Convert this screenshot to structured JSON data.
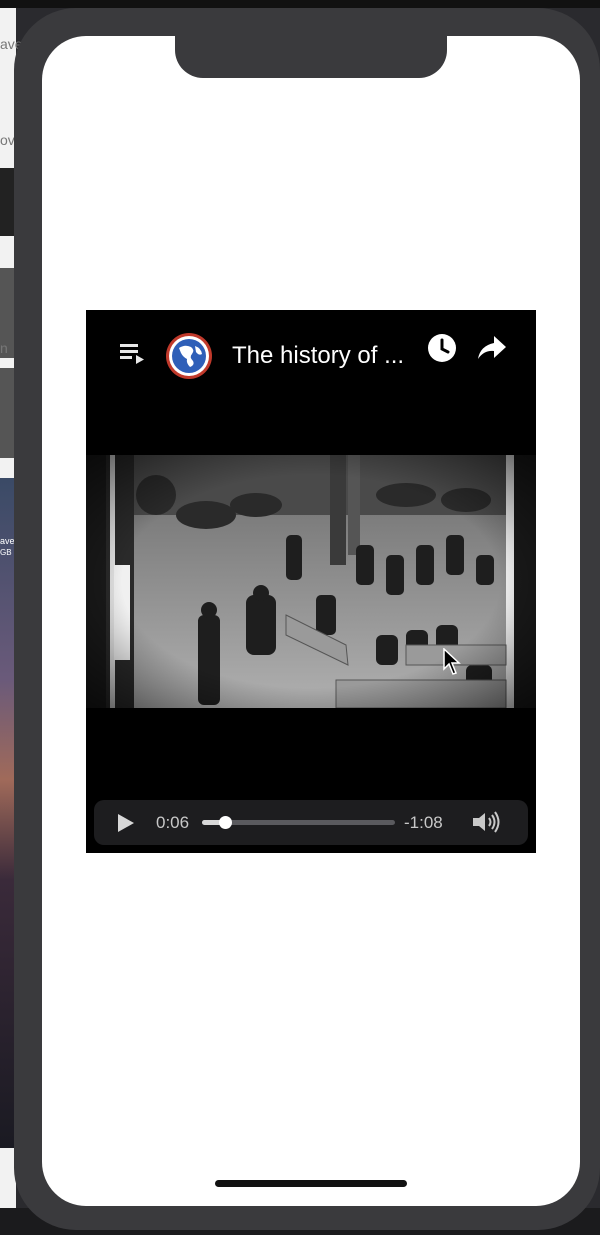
{
  "desktop": {
    "sidebar_fragments": [
      "ave",
      "ov",
      "n",
      "ave",
      "GB"
    ]
  },
  "player": {
    "title": "The history of ...",
    "controls": {
      "elapsed": "0:06",
      "remaining": "-1:08",
      "progress": 0.12
    }
  },
  "colors": {
    "player_bg": "#000000",
    "controls_bg": "#1d1d1f",
    "phone_frame": "#3a3a3d"
  },
  "icons": {
    "playlist": "playlist-icon",
    "channel": "globe-logo-icon",
    "watch_later": "clock-icon",
    "share": "share-arrow-icon",
    "play": "play-icon",
    "volume": "volume-icon",
    "cursor": "mouse-pointer-icon"
  }
}
